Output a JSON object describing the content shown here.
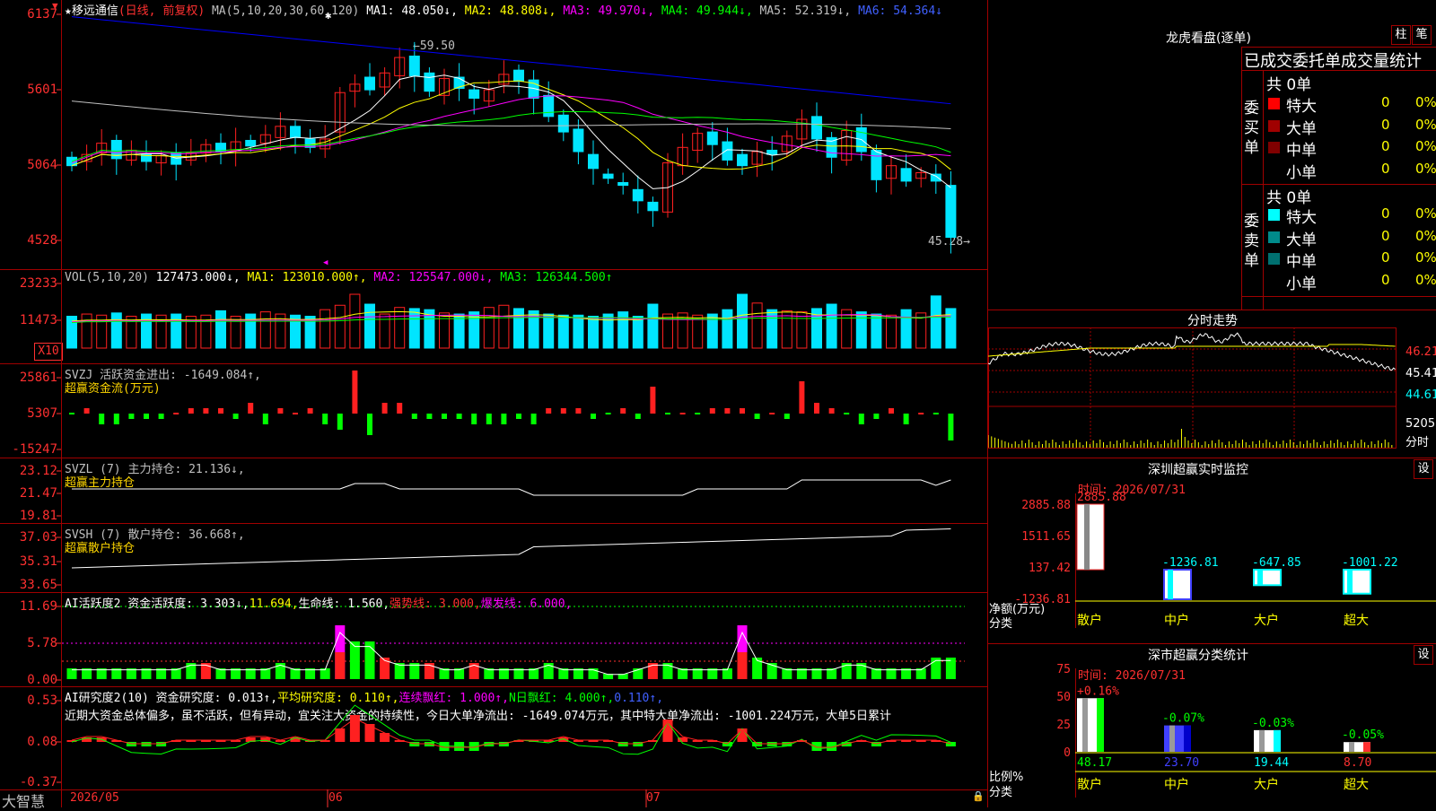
{
  "colors": {
    "up": "#ff2020",
    "down": "#00e5ff",
    "bg": "#000000",
    "grid": "#a00000",
    "ma1": "#ffffff",
    "ma2": "#ffff00",
    "ma3": "#ff00ff",
    "ma4": "#00ff00",
    "ma5": "#c0c0c0",
    "ma6": "#0000ff"
  },
  "main": {
    "star": "★",
    "stock_name": "移远通信",
    "period": "(日线, 前复权)",
    "ma_params": "MA(5,10,20,30,60,120)",
    "ma1": "MA1: 48.050↓,",
    "ma2": "MA2: 48.808↓,",
    "ma3": "MA3: 49.970↓,",
    "ma4": "MA4: 49.944↓,",
    "ma5": "MA5: 52.319↓,",
    "ma6": "MA6: 54.364↓",
    "y_labels": [
      "6137",
      "5601",
      "5064",
      "4528"
    ],
    "high_label": "59.50",
    "low_label": "45.28"
  },
  "vol": {
    "name": "VOL(5,10,20)",
    "val": "127473.000↓,",
    "ma1": "MA1: 123010.000↑,",
    "ma2": "MA2: 125547.000↓,",
    "ma3": "MA3: 126344.500↑",
    "y_labels": [
      "23233",
      "11473"
    ],
    "unit": "X10"
  },
  "svzj": {
    "name": "SVZJ  活跃资金进出: -1649.084↑,",
    "sub": "超赢资金流(万元)",
    "y_labels": [
      "25861",
      "5307",
      "-15247"
    ]
  },
  "svzl": {
    "name": "SVZL (7) 主力持仓: 21.136↓,",
    "sub": "超赢主力持仓",
    "y_labels": [
      "23.12",
      "21.47",
      "19.81"
    ]
  },
  "svsh": {
    "name": "SVSH (7) 散户持仓: 36.668↑,",
    "sub": "超赢散户持仓",
    "y_labels": [
      "37.03",
      "35.31",
      "33.65"
    ]
  },
  "ai1": {
    "name": "AI活跃度2 资金活跃度: 3.303↓,",
    "v1": "11.694,",
    "v2": "生命线: 1.560,",
    "v3": "强势线: 3.000,",
    "v4": "爆发线: 6.000,",
    "y_labels": [
      "11.69",
      "5.78",
      "0.00"
    ]
  },
  "ai2": {
    "name": "AI研究度2(10) 资金研究度: 0.013↑,",
    "v1": "平均研究度: 0.110↑,",
    "v2": "连续飘红: 1.000↑,",
    "v3": "N日飘红: 4.000↑,",
    "v4": "0.110↑,",
    "desc": "近期大资金总体偏多，虽不活跃，但有异动，宜关注大资金的持续性，今日大单净流出: -1649.074万元，其中特大单净流出: -1001.224万元，大单5日累计",
    "y_labels": [
      "0.53",
      "0.08",
      "-0.37"
    ]
  },
  "footer": {
    "logo": "大智慧",
    "months": [
      "2026/05",
      "06",
      "07"
    ]
  },
  "dragon": {
    "title": "龙虎看盘(逐单)",
    "btn1": "柱",
    "btn2": "笔",
    "tabs": "已成交委托单成交量统计",
    "buy_label": "委买单",
    "sell_label": "委卖单",
    "buy_total": "共 0单",
    "sell_total": "共 0单",
    "buy_rows": [
      {
        "name": "特大",
        "val": "0",
        "pct": "0%",
        "color": "#ff0000"
      },
      {
        "name": "大单",
        "val": "0",
        "pct": "0%",
        "color": "#a00000"
      },
      {
        "name": "中单",
        "val": "0",
        "pct": "0%",
        "color": "#800000"
      },
      {
        "name": "小单",
        "val": "0",
        "pct": "0%",
        "color": "#000000"
      }
    ],
    "sell_rows": [
      {
        "name": "特大",
        "val": "0",
        "pct": "0%",
        "color": "#00ffff"
      },
      {
        "name": "大单",
        "val": "0",
        "pct": "0%",
        "color": "#008b8b"
      },
      {
        "name": "中单",
        "val": "0",
        "pct": "0%",
        "color": "#007070"
      },
      {
        "name": "小单",
        "val": "0",
        "pct": "0%",
        "color": "#000000"
      }
    ]
  },
  "intraday": {
    "title": "分时走势",
    "y_labels": [
      "46.21",
      "45.41",
      "44.61"
    ],
    "vol_label": "5205",
    "vol_unit": "分时"
  },
  "monitor": {
    "title": "深圳超赢实时监控",
    "btn": "设",
    "time": "时间: 2026/07/31",
    "y_labels": [
      "2885.88",
      "1511.65",
      "137.42",
      "-1236.81"
    ],
    "axis_title": "净额(万元)",
    "axis_sub": "分类",
    "cats": [
      "散户",
      "中户",
      "大户",
      "超大"
    ],
    "values": [
      "2885.88",
      "-1236.81",
      "-647.85",
      "-1001.22"
    ]
  },
  "stats": {
    "title": "深市超赢分类统计",
    "btn": "设",
    "time": "时间: 2026/07/31",
    "y_labels": [
      "75",
      "50",
      "25",
      "0"
    ],
    "axis_title": "比例%",
    "axis_sub": "分类",
    "cats": [
      "散户",
      "中户",
      "大户",
      "超大"
    ],
    "changes": [
      "+0.16%",
      "-0.07%",
      "-0.03%",
      "-0.05%"
    ],
    "values": [
      "48.17",
      "23.70",
      "19.44",
      "8.70"
    ]
  }
}
